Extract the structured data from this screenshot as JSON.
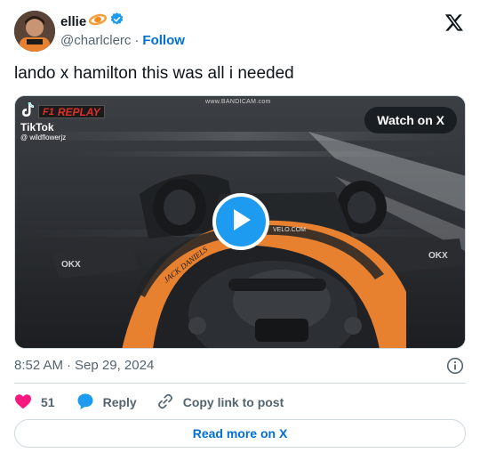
{
  "author": {
    "display_name": "ellie",
    "handle": "@charlclerc",
    "separator": "·",
    "follow_label": "Follow",
    "name_emoji_icon": "orange-ring-icon",
    "verified_icon": "verified-badge-icon"
  },
  "tweet": {
    "text": "lando x hamilton this was all i needed"
  },
  "media": {
    "tiktok_label": "TikTok",
    "tiktok_user": "@ wildflowerjz",
    "replay_label": "REPLAY",
    "f1_label": "F1",
    "watermark": "www.BANDICAM.com",
    "watch_label": "Watch on X",
    "car_text_1": "JACK DANIELS",
    "car_text_2": "VELO.COM",
    "car_text_3": "OKX",
    "car_text_4": "OKX"
  },
  "meta": {
    "time": "8:52 AM",
    "separator": "·",
    "date": "Sep 29, 2024"
  },
  "actions": {
    "like_count": "51",
    "reply_label": "Reply",
    "copy_label": "Copy link to post"
  },
  "footer": {
    "read_more_label": "Read more on X"
  },
  "colors": {
    "link": "#006fd6",
    "like": "#f91880",
    "reply": "#1d9bf0",
    "play": "#1d9bf0",
    "mclaren_orange": "#e8812f"
  }
}
